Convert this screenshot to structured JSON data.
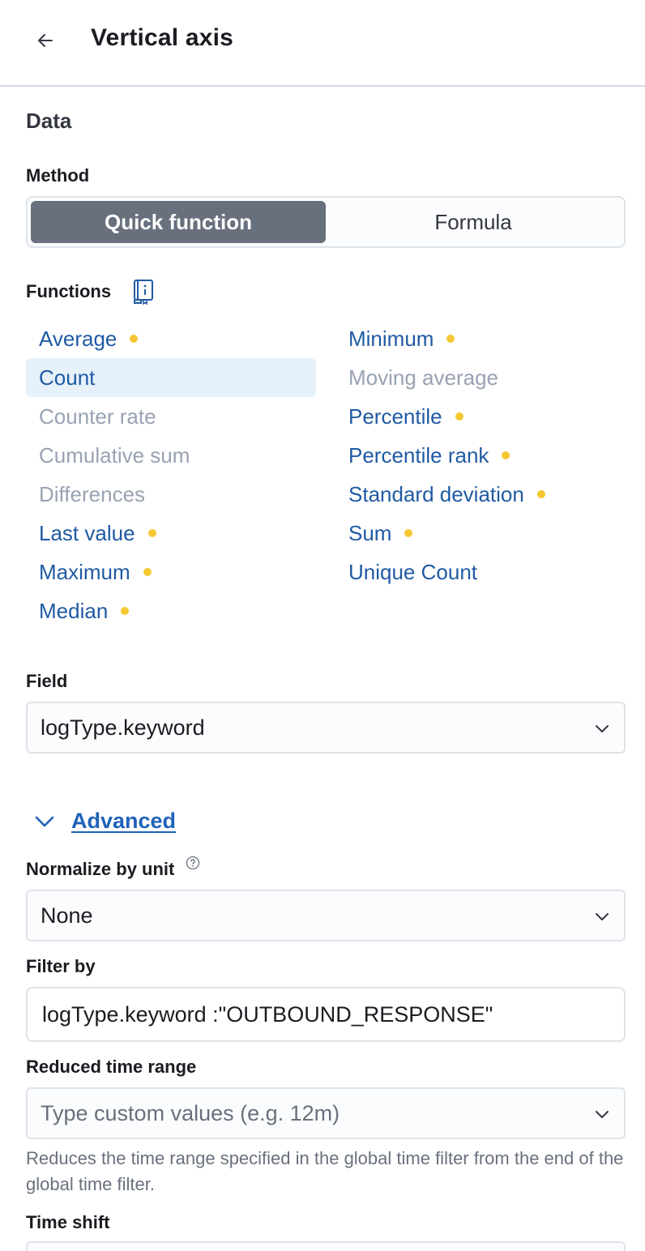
{
  "header": {
    "title": "Vertical axis",
    "back_icon": "arrow-left-icon"
  },
  "data_section": {
    "title": "Data",
    "method_label": "Method",
    "method_options": [
      "Quick function",
      "Formula"
    ],
    "method_selected": "Quick function",
    "functions_label": "Functions",
    "functions_docs_icon": "documentation-book-icon",
    "functions_left": [
      {
        "label": "Average",
        "enabled": true,
        "dot": true
      },
      {
        "label": "Count",
        "enabled": true,
        "dot": false,
        "selected": true
      },
      {
        "label": "Counter rate",
        "enabled": false,
        "dot": false
      },
      {
        "label": "Cumulative sum",
        "enabled": false,
        "dot": false
      },
      {
        "label": "Differences",
        "enabled": false,
        "dot": false
      },
      {
        "label": "Last value",
        "enabled": true,
        "dot": true
      },
      {
        "label": "Maximum",
        "enabled": true,
        "dot": true
      },
      {
        "label": "Median",
        "enabled": true,
        "dot": true
      }
    ],
    "functions_right": [
      {
        "label": "Minimum",
        "enabled": true,
        "dot": true
      },
      {
        "label": "Moving average",
        "enabled": false,
        "dot": false
      },
      {
        "label": "Percentile",
        "enabled": true,
        "dot": true
      },
      {
        "label": "Percentile rank",
        "enabled": true,
        "dot": true
      },
      {
        "label": "Standard deviation",
        "enabled": true,
        "dot": true
      },
      {
        "label": "Sum",
        "enabled": true,
        "dot": true
      },
      {
        "label": "Unique Count",
        "enabled": true,
        "dot": false
      }
    ],
    "field_label": "Field",
    "field_value": "logType.keyword"
  },
  "advanced": {
    "toggle_label": "Advanced",
    "normalize_label": "Normalize by unit",
    "normalize_value": "None",
    "filter_label": "Filter by",
    "filter_value": "logType.keyword :\"OUTBOUND_RESPONSE\"",
    "reduced_time_label": "Reduced time range",
    "reduced_time_placeholder": "Type custom values (e.g. 12m)",
    "reduced_time_help": "Reduces the time range specified in the global time filter from the end of the global time filter.",
    "time_shift_label": "Time shift"
  },
  "colors": {
    "link_blue": "#1f5aa3",
    "disabled_gray": "#98a2b3",
    "selected_bg": "#e6f1fa",
    "active_button": "#69707d",
    "dot_yellow": "#f5c832"
  }
}
